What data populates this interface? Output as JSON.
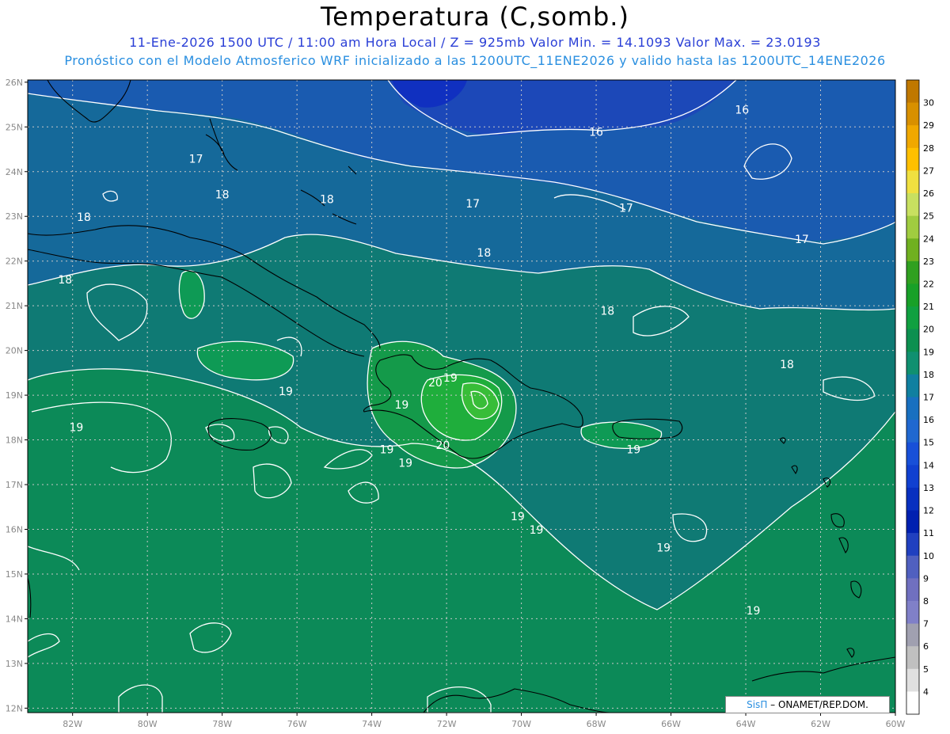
{
  "title": "Temperatura (C,somb.)",
  "subtitle_line1": "11-Ene-2026  1500 UTC / 11:00 am Hora Local / Z = 925mb   Valor Min. = 14.1093  Valor Max. = 23.0193",
  "subtitle_line2": "Pronóstico con el Modelo Atmosferico WRF inicializado a las 1200UTC_11ENE2026 y valido hasta las  1200UTC_14ENE2026",
  "credit": {
    "brand": "SisΠ",
    "org": "– ONAMET/REP.DOM."
  },
  "axes": {
    "lat_labels": [
      "26N",
      "25N",
      "24N",
      "23N",
      "22N",
      "21N",
      "20N",
      "19N",
      "18N",
      "17N",
      "16N",
      "15N",
      "14N",
      "13N",
      "12N"
    ],
    "lon_labels": [
      "82W",
      "80W",
      "78W",
      "76W",
      "74W",
      "72W",
      "70W",
      "68W",
      "66W",
      "64W",
      "62W",
      "60W"
    ]
  },
  "colorbar": {
    "labels": [
      "30",
      "29",
      "28",
      "27",
      "26",
      "25",
      "24",
      "23",
      "22",
      "21",
      "20",
      "19",
      "18",
      "17",
      "16",
      "15",
      "14",
      "13",
      "12",
      "11",
      "10",
      "9",
      "8",
      "7",
      "6",
      "5",
      "4"
    ],
    "colors": [
      "#c07800",
      "#d89000",
      "#f0a800",
      "#ffc000",
      "#f0e040",
      "#c8e060",
      "#a0cc40",
      "#70b020",
      "#30a020",
      "#18a028",
      "#10a040",
      "#0c9050",
      "#109070",
      "#1080a0",
      "#1870c0",
      "#2068d0",
      "#1850d8",
      "#1040d0",
      "#0830c0",
      "#0020b0",
      "#2040c0",
      "#5060c0",
      "#7070c0",
      "#8080c8",
      "#a0a0b0",
      "#c0c0c0",
      "#e0e0e0",
      "#ffffff"
    ]
  },
  "contour_labels": [
    {
      "text": "16",
      "lat": 25.3,
      "lon": -64.1
    },
    {
      "text": "16",
      "lat": 24.8,
      "lon": -68.0
    },
    {
      "text": "17",
      "lat": 24.2,
      "lon": -78.7
    },
    {
      "text": "17",
      "lat": 23.2,
      "lon": -71.3
    },
    {
      "text": "17",
      "lat": 23.1,
      "lon": -67.2
    },
    {
      "text": "17",
      "lat": 22.4,
      "lon": -62.5
    },
    {
      "text": "18",
      "lat": 23.4,
      "lon": -78.0
    },
    {
      "text": "18",
      "lat": 23.3,
      "lon": -75.2
    },
    {
      "text": "18",
      "lat": 22.9,
      "lon": -81.7
    },
    {
      "text": "18",
      "lat": 22.1,
      "lon": -71.0
    },
    {
      "text": "18",
      "lat": 21.5,
      "lon": -82.2
    },
    {
      "text": "18",
      "lat": 20.8,
      "lon": -67.7
    },
    {
      "text": "18",
      "lat": 19.6,
      "lon": -62.9
    },
    {
      "text": "19",
      "lat": 19.3,
      "lon": -71.9
    },
    {
      "text": "19",
      "lat": 19.0,
      "lon": -76.3
    },
    {
      "text": "19",
      "lat": 18.7,
      "lon": -73.2
    },
    {
      "text": "19",
      "lat": 18.2,
      "lon": -81.9
    },
    {
      "text": "19",
      "lat": 17.7,
      "lon": -73.6
    },
    {
      "text": "19",
      "lat": 17.4,
      "lon": -73.1
    },
    {
      "text": "19",
      "lat": 17.7,
      "lon": -67.0
    },
    {
      "text": "19",
      "lat": 16.2,
      "lon": -70.1
    },
    {
      "text": "19",
      "lat": 15.9,
      "lon": -69.6
    },
    {
      "text": "19",
      "lat": 15.5,
      "lon": -66.2
    },
    {
      "text": "19",
      "lat": 14.1,
      "lon": -63.8
    },
    {
      "text": "20",
      "lat": 19.2,
      "lon": -72.3
    },
    {
      "text": "20",
      "lat": 17.8,
      "lon": -72.1
    }
  ],
  "color_legend_note": ""
}
